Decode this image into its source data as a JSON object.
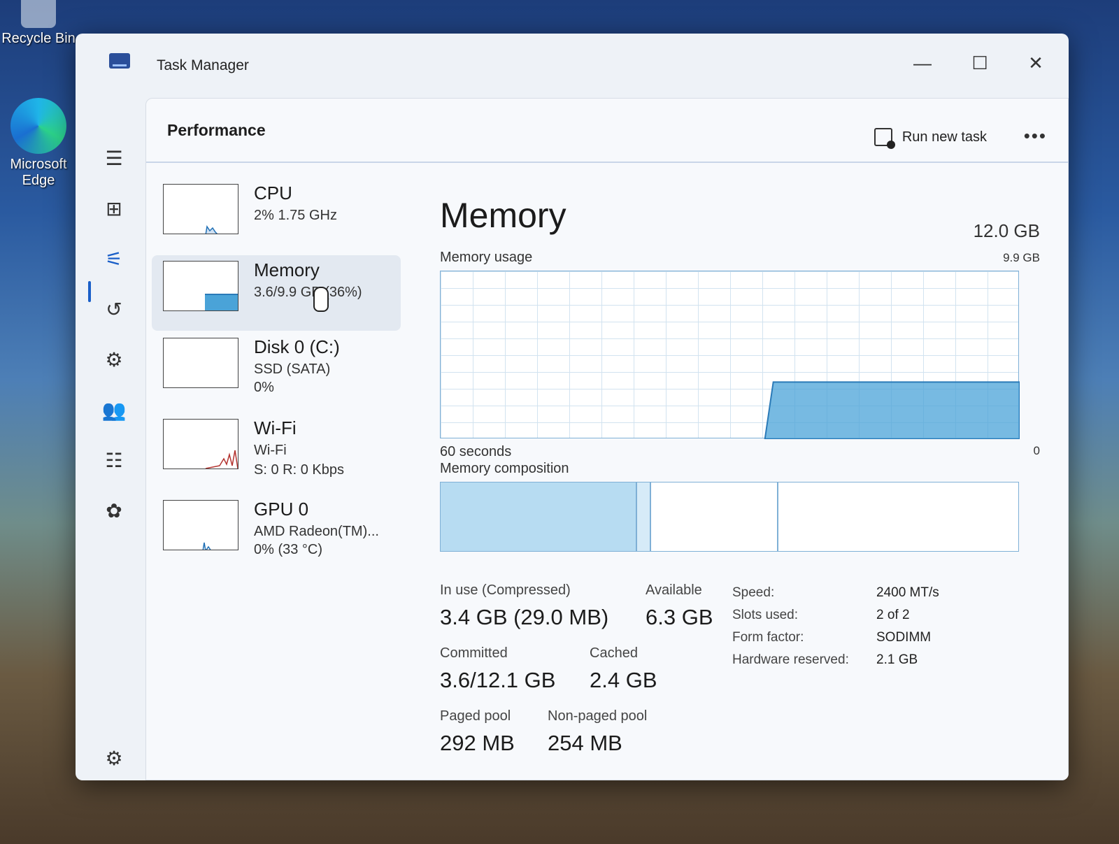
{
  "desktop": {
    "icons": [
      {
        "label": "Recycle Bin"
      },
      {
        "label": "Microsoft Edge"
      }
    ]
  },
  "window": {
    "title": "Task Manager",
    "controls": {
      "minimize": "—",
      "maximize": "☐",
      "close": "✕"
    }
  },
  "nav": {
    "items": [
      {
        "icon": "hamburger-icon",
        "glyph": "☰"
      },
      {
        "icon": "processes-icon",
        "glyph": "⊞"
      },
      {
        "icon": "performance-icon",
        "glyph": "⚟"
      },
      {
        "icon": "app-history-icon",
        "glyph": "↺"
      },
      {
        "icon": "startup-apps-icon",
        "glyph": "⚙"
      },
      {
        "icon": "users-icon",
        "glyph": "👥"
      },
      {
        "icon": "details-icon",
        "glyph": "☷"
      },
      {
        "icon": "services-icon",
        "glyph": "✿"
      },
      {
        "icon": "settings-icon",
        "glyph": "⚙"
      }
    ],
    "selected_index": 2
  },
  "header": {
    "title": "Performance",
    "run_new_task": "Run new task",
    "more": "•••"
  },
  "devices": [
    {
      "name": "CPU",
      "line1": "2%  1.75 GHz",
      "line2": "",
      "color": "#1f6fb5"
    },
    {
      "name": "Memory",
      "line1": "3.6/9.9 GB (36%)",
      "line2": "",
      "color": "#4aa3d8",
      "selected": true
    },
    {
      "name": "Disk 0 (C:)",
      "line1": "SSD (SATA)",
      "line2": "0%",
      "color": "#3a9a3a"
    },
    {
      "name": "Wi-Fi",
      "line1": "Wi-Fi",
      "line2": "S: 0  R: 0 Kbps",
      "color": "#b3322e"
    },
    {
      "name": "GPU 0",
      "line1": "AMD Radeon(TM)...",
      "line2": "0%  (33 °C)",
      "color": "#1f6fb5"
    }
  ],
  "memory": {
    "title": "Memory",
    "total": "12.0 GB",
    "usage_label": "Memory usage",
    "usage_max": "9.9 GB",
    "time_label": "60 seconds",
    "usage_min": "0",
    "composition_label": "Memory composition",
    "in_use_label": "In use (Compressed)",
    "in_use_value": "3.4 GB (29.0 MB)",
    "available_label": "Available",
    "available_value": "6.3 GB",
    "committed_label": "Committed",
    "committed_value": "3.6/12.1 GB",
    "cached_label": "Cached",
    "cached_value": "2.4 GB",
    "paged_label": "Paged pool",
    "paged_value": "292 MB",
    "nonpaged_label": "Non-paged pool",
    "nonpaged_value": "254 MB",
    "props": [
      {
        "key": "Speed:",
        "value": "2400 MT/s"
      },
      {
        "key": "Slots used:",
        "value": "2 of 2"
      },
      {
        "key": "Form factor:",
        "value": "SODIMM"
      },
      {
        "key": "Hardware reserved:",
        "value": "2.1 GB"
      }
    ],
    "usage_fraction": 0.34,
    "composition_fractions": {
      "in_use": 0.34,
      "modified": 0.025,
      "standby": 0.22
    },
    "accent": "#4aa3d8"
  }
}
